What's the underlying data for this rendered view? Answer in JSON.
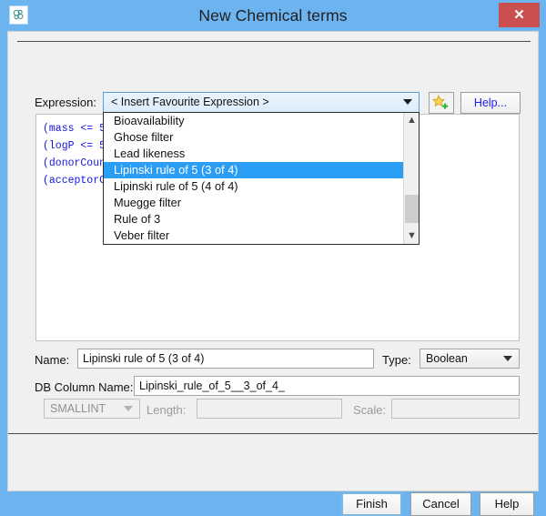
{
  "window": {
    "title": "New Chemical terms",
    "app_icon": "molecule-icon",
    "close_label": "✕",
    "accent_blue": "#6cb4f0",
    "close_red": "#c9504e",
    "highlight_blue": "#2a9df4"
  },
  "expression": {
    "label": "Expression:",
    "combo_value": "< Insert Favourite Expression >",
    "add_favourite_icon": "star-plus-icon",
    "help_label": "Help...",
    "code_lines": [
      "(mass <= 5",
      "(logP <= 5",
      "(donorCoun",
      "(acceptorC"
    ]
  },
  "dropdown": {
    "items": [
      "Bioavailability",
      "Ghose filter",
      "Lead likeness",
      "Lipinski rule of 5 (3 of 4)",
      "Lipinski rule of 5 (4 of 4)",
      "Muegge filter",
      "Rule of 3",
      "Veber filter"
    ],
    "selected_index": 3,
    "scroll_up_icon": "chevron-up-icon",
    "scroll_down_icon": "chevron-down-icon"
  },
  "name_row": {
    "label": "Name:",
    "value": "Lipinski rule of 5 (3 of 4)",
    "type_label": "Type:",
    "type_value": "Boolean"
  },
  "db_column_row": {
    "label": "DB Column Name:",
    "value": "Lipinski_rule_of_5__3_of_4_"
  },
  "sql_row": {
    "sql_type": "SMALLINT",
    "length_label": "Length:",
    "length_value": "",
    "scale_label": "Scale:",
    "scale_value": "",
    "enabled": false
  },
  "footer": {
    "finish_label": "Finish",
    "cancel_label": "Cancel",
    "help_label": "Help"
  }
}
